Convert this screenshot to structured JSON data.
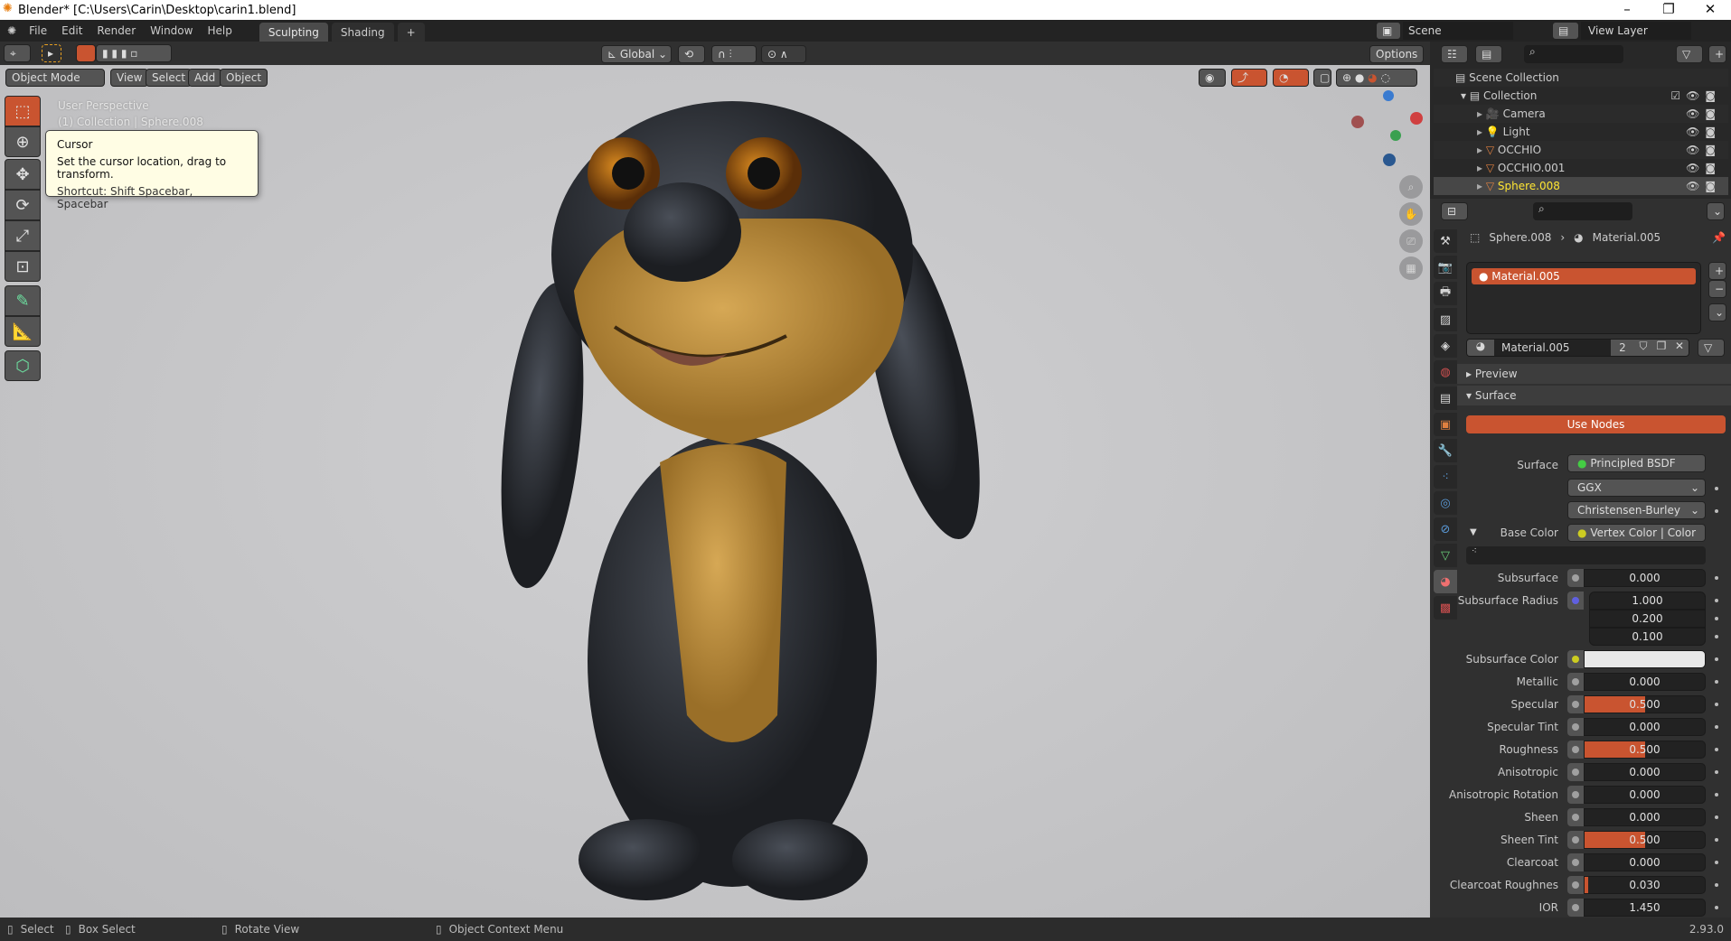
{
  "window": {
    "title": "Blender* [C:\\Users\\Carin\\Desktop\\carin1.blend]",
    "minimize": "–",
    "maximize": "❐",
    "close": "✕"
  },
  "menu": [
    "File",
    "Edit",
    "Render",
    "Window",
    "Help"
  ],
  "workspaces": [
    {
      "label": "Sculpting",
      "active": true
    },
    {
      "label": "Shading",
      "active": false
    },
    {
      "label": "+",
      "active": false
    }
  ],
  "scene": {
    "scene_name": "Scene",
    "view_layer": "View Layer"
  },
  "header": {
    "orientation": "Global",
    "options": "Options"
  },
  "viewport_header": {
    "mode": "Object Mode",
    "view": "View",
    "select": "Select",
    "add": "Add",
    "object": "Object"
  },
  "viewport": {
    "perspective": "User Perspective",
    "collection_info": "(1) Collection | Sphere.008"
  },
  "tooltip": {
    "title": "Cursor",
    "description": "Set the cursor location, drag to transform.",
    "shortcut": "Shortcut: Shift Spacebar, Spacebar"
  },
  "outliner": {
    "root": "Scene Collection",
    "collection": "Collection",
    "items": [
      {
        "name": "Camera",
        "type": "camera"
      },
      {
        "name": "Light",
        "type": "light"
      },
      {
        "name": "OCCHIO",
        "type": "mesh"
      },
      {
        "name": "OCCHIO.001",
        "type": "mesh"
      },
      {
        "name": "Sphere.008",
        "type": "mesh",
        "selected": true
      }
    ]
  },
  "properties": {
    "breadcrumb_object": "Sphere.008",
    "breadcrumb_material": "Material.005",
    "slot": "Material.005",
    "material_name": "Material.005",
    "users": "2",
    "preview": "Preview",
    "surface_panel": "Surface",
    "use_nodes": "Use Nodes",
    "surface_label": "Surface",
    "surface_value": "Principled BSDF",
    "distribution": "GGX",
    "subsurface_method": "Christensen-Burley",
    "base_color_label": "Base Color",
    "base_color_value": "Vertex Color | Color",
    "fields": [
      {
        "label": "Subsurface",
        "value": "0.000",
        "fraction": 0
      },
      {
        "label": "Subsurface Radius",
        "values": [
          "1.000",
          "0.200",
          "0.100"
        ]
      },
      {
        "label": "Subsurface Color",
        "color": "#e8e8e8"
      },
      {
        "label": "Metallic",
        "value": "0.000",
        "fraction": 0
      },
      {
        "label": "Specular",
        "value": "0.500",
        "fraction": 0.5
      },
      {
        "label": "Specular Tint",
        "value": "0.000",
        "fraction": 0
      },
      {
        "label": "Roughness",
        "value": "0.500",
        "fraction": 0.5
      },
      {
        "label": "Anisotropic",
        "value": "0.000",
        "fraction": 0
      },
      {
        "label": "Anisotropic Rotation",
        "value": "0.000",
        "fraction": 0
      },
      {
        "label": "Sheen",
        "value": "0.000",
        "fraction": 0
      },
      {
        "label": "Sheen Tint",
        "value": "0.500",
        "fraction": 0.5
      },
      {
        "label": "Clearcoat",
        "value": "0.000",
        "fraction": 0
      },
      {
        "label": "Clearcoat Roughnes",
        "value": "0.030",
        "fraction": 0.03
      },
      {
        "label": "IOR",
        "value": "1.450",
        "fraction": 0
      }
    ]
  },
  "status": {
    "select": "Select",
    "box_select": "Box Select",
    "rotate": "Rotate View",
    "context_menu": "Object Context Menu",
    "version": "2.93.0"
  },
  "colors": {
    "accent": "#c95430",
    "selected_text": "#ffe633"
  }
}
